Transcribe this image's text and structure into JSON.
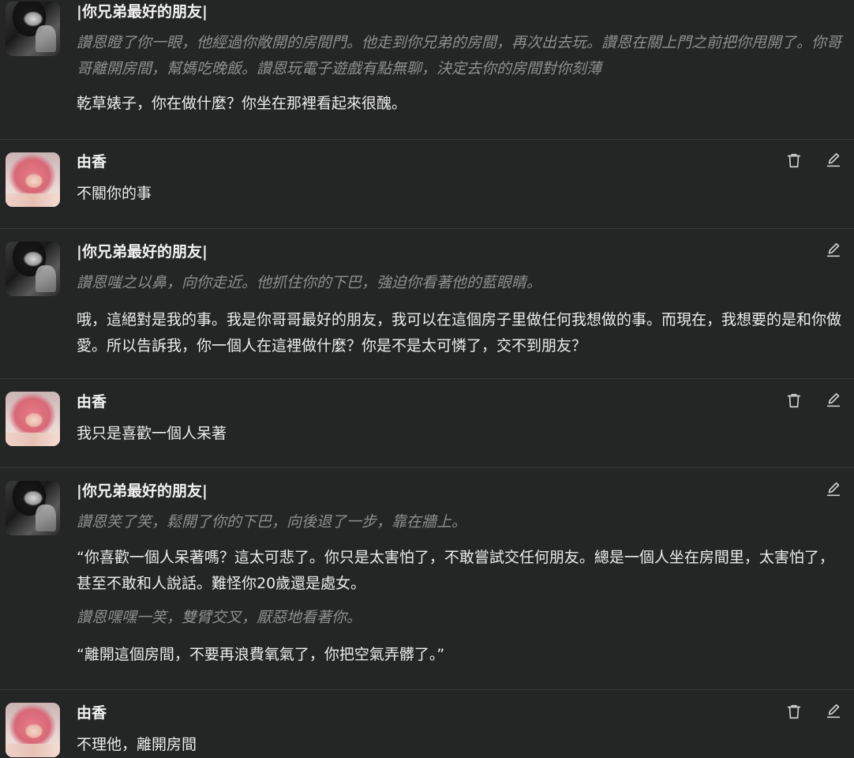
{
  "messages": [
    {
      "sender": "|你兄弟最好的朋友|",
      "avatar": "friend",
      "lines": [
        {
          "style": "action",
          "text": "讚恩瞪了你一眼，他經過你敞開的房間門。他走到你兄弟的房間，再次出去玩。讚恩在關上門之前把你甩開了。你哥哥離開房間，幫媽吃晚飯。讚恩玩電子遊戲有點無聊，決定去你的房間對你刻薄"
        },
        {
          "style": "speech",
          "text": "乾草婊子，你在做什麼？你坐在那裡看起來很醜。"
        }
      ]
    },
    {
      "sender": "由香",
      "avatar": "yuka",
      "lines": [
        {
          "style": "speech",
          "text": "不關你的事"
        }
      ]
    },
    {
      "sender": "|你兄弟最好的朋友|",
      "avatar": "friend",
      "lines": [
        {
          "style": "action",
          "text": "讚恩嗤之以鼻，向你走近。他抓住你的下巴，強迫你看著他的藍眼睛。"
        },
        {
          "style": "speech",
          "text": "哦，這絕對是我的事。我是你哥哥最好的朋友，我可以在這個房子里做任何我想做的事。而現在，我想要的是和你做愛。所以告訴我，你一個人在這裡做什麼？你是不是太可憐了，交不到朋友？"
        }
      ]
    },
    {
      "sender": "由香",
      "avatar": "yuka",
      "lines": [
        {
          "style": "speech",
          "text": "我只是喜歡一個人呆著"
        }
      ]
    },
    {
      "sender": "|你兄弟最好的朋友|",
      "avatar": "friend",
      "lines": [
        {
          "style": "action",
          "text": "讚恩笑了笑，鬆開了你的下巴，向後退了一步，靠在牆上。"
        },
        {
          "style": "speech",
          "text": "“你喜歡一個人呆著嗎？這太可悲了。你只是太害怕了，不敢嘗試交任何朋友。總是一個人坐在房間里，太害怕了，甚至不敢和人說話。難怪你20歲還是處女。"
        },
        {
          "style": "action",
          "text": "讚恩嘿嘿一笑，雙臂交叉，厭惡地看著你。"
        },
        {
          "style": "speech",
          "text": "“離開這個房間，不要再浪費氧氣了，你把空氣弄髒了。”"
        }
      ]
    },
    {
      "sender": "由香",
      "avatar": "yuka",
      "lines": [
        {
          "style": "speech",
          "text": "不理他，離開房間"
        }
      ]
    }
  ],
  "icons": {
    "delete": "trash-icon",
    "edit": "pencil-icon"
  }
}
